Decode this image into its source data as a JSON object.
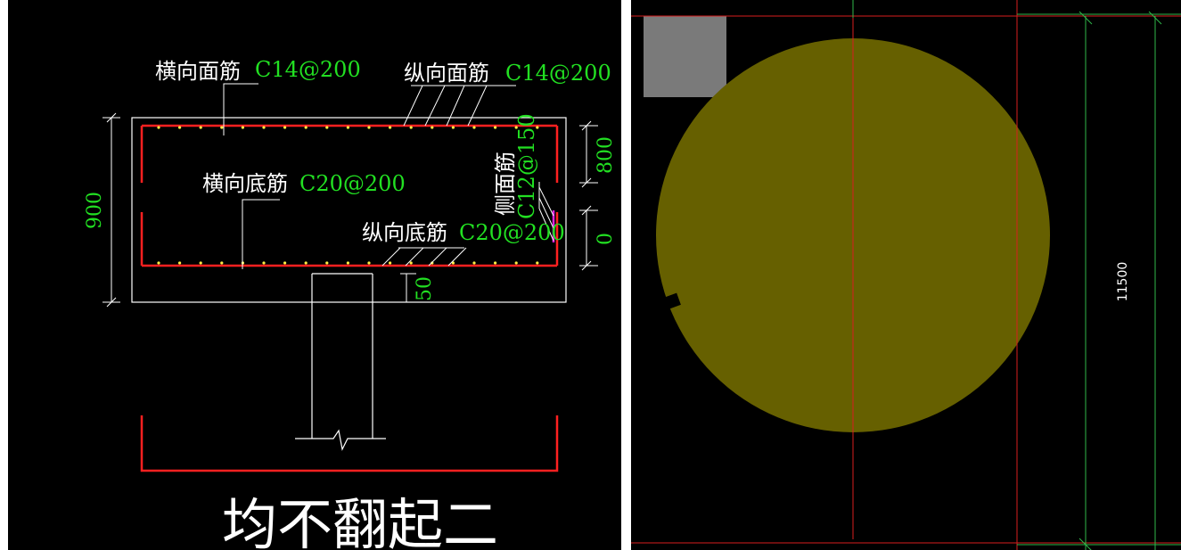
{
  "left": {
    "top_transverse": {
      "name": "横向面筋",
      "spec": "C14@200"
    },
    "top_longitudinal": {
      "name": "纵向面筋",
      "spec": "C14@200"
    },
    "bottom_transverse": {
      "name": "横向底筋",
      "spec": "C20@200"
    },
    "bottom_longitudinal": {
      "name": "纵向底筋",
      "spec": "C20@200"
    },
    "side": {
      "name": "侧面筋",
      "spec": "C12@150"
    },
    "dims": {
      "height": "900",
      "upper": "800",
      "lower": "0",
      "cover": "50"
    },
    "caption": "均不翻起二"
  },
  "right": {
    "dimension": "11500"
  },
  "colors": {
    "rebar": "#ff2020",
    "label_green": "#22e022",
    "circle_fill": "#666000",
    "grid_red": "#d81e1e",
    "grid_green": "#2fb84a",
    "gray_box": "#7a7a7a"
  }
}
